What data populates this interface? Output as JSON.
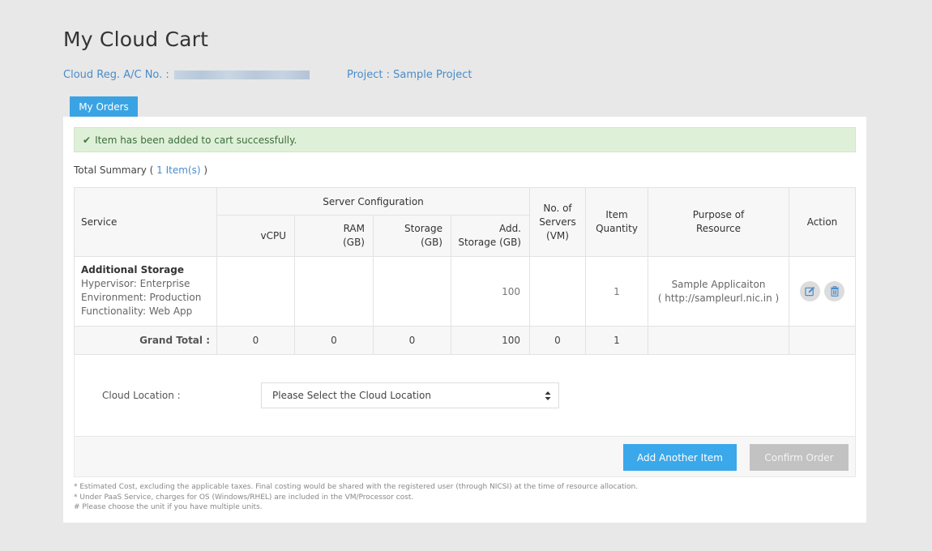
{
  "header": {
    "title": "My Cloud Cart",
    "account_label": "Cloud Reg. A/C No. :",
    "account_value_masked": true,
    "project_label": "Project : Sample Project"
  },
  "tabs": [
    {
      "label": "My Orders",
      "active": true
    }
  ],
  "alert": {
    "type": "success",
    "icon": "check-icon",
    "message": "Item has been added to cart successfully."
  },
  "summary": {
    "label": "Total Summary (",
    "count_text": "1 Item(s)",
    "close": ")"
  },
  "table": {
    "headers": {
      "service": "Service",
      "server_config": "Server Configuration",
      "vcpu": "vCPU",
      "ram_line1": "RAM",
      "ram_line2": "(GB)",
      "storage_line1": "Storage",
      "storage_line2": "(GB)",
      "add_storage_line1": "Add.",
      "add_storage_line2": "Storage (GB)",
      "servers_line1": "No. of",
      "servers_line2": "Servers",
      "servers_line3": "(VM)",
      "qty_line1": "Item",
      "qty_line2": "Quantity",
      "purpose_line1": "Purpose of",
      "purpose_line2": "Resource",
      "action": "Action"
    },
    "rows": [
      {
        "service_name": "Additional Storage",
        "details": [
          "Hypervisor: Enterprise",
          "Environment: Production",
          "Functionality: Web App"
        ],
        "vcpu": "",
        "ram": "",
        "storage": "",
        "add_storage": "100",
        "servers": "",
        "quantity": "1",
        "purpose_name": "Sample Applicaiton",
        "purpose_url": "( http://sampleurl.nic.in )",
        "actions": [
          "edit-icon",
          "delete-icon"
        ]
      }
    ],
    "grand_total": {
      "label": "Grand Total :",
      "vcpu": "0",
      "ram": "0",
      "storage": "0",
      "add_storage": "100",
      "servers": "0",
      "quantity": "1"
    }
  },
  "location": {
    "label": "Cloud Location :",
    "selected": "Please Select the Cloud Location"
  },
  "buttons": {
    "add_another": "Add Another Item",
    "confirm": "Confirm Order"
  },
  "notes": [
    "* Estimated Cost, excluding the applicable taxes. Final costing would be shared with the registered user (through NICSI) at the time of resource allocation.",
    "* Under PaaS Service, charges for OS (Windows/RHEL) are included in the VM/Processor cost.",
    "# Please choose the unit if you have multiple units."
  ],
  "colors": {
    "accent": "#3aa3e3",
    "link": "#4a8cc9",
    "success_bg": "#dff0d8",
    "disabled_button": "#c2c2c2",
    "page_bg": "#e8e8e8"
  }
}
